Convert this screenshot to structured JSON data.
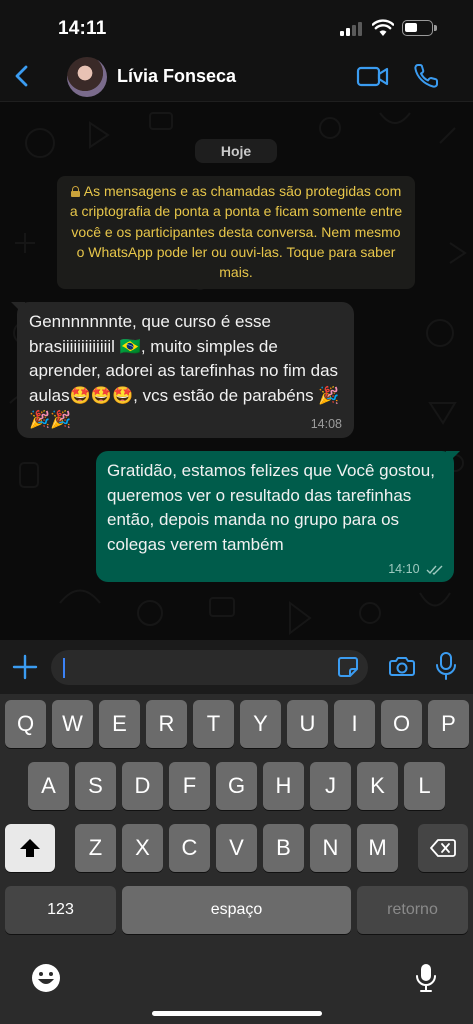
{
  "status_bar": {
    "time": "14:11"
  },
  "header": {
    "contact_name": "Lívia Fonseca"
  },
  "chat": {
    "date_label": "Hoje",
    "encryption_notice": "As mensagens e as chamadas são protegidas com a criptografia de ponta a ponta e ficam somente entre você e os participantes desta conversa. Nem mesmo o WhatsApp pode ler ou ouvi-las. Toque para saber mais.",
    "messages": [
      {
        "direction": "in",
        "text": "Gennnnnnnte, que curso é esse brasiiiiiiiiiiiiil 🇧🇷, muito simples de aprender, adorei as tarefinhas no fim das aulas🤩🤩🤩, vcs estão de parabéns 🎉🎉🎉",
        "time": "14:08"
      },
      {
        "direction": "out",
        "text": "Gratidão, estamos felizes que Você gostou, queremos ver o resultado das tarefinhas então, depois manda no grupo para os colegas verem também",
        "time": "14:10",
        "status": "read"
      }
    ]
  },
  "composer": {
    "value": "",
    "placeholder": ""
  },
  "keyboard": {
    "row1": [
      "Q",
      "W",
      "E",
      "R",
      "T",
      "Y",
      "U",
      "I",
      "O",
      "P"
    ],
    "row2": [
      "A",
      "S",
      "D",
      "F",
      "G",
      "H",
      "J",
      "K",
      "L"
    ],
    "row3": [
      "Z",
      "X",
      "C",
      "V",
      "B",
      "N",
      "M"
    ],
    "numbers_label": "123",
    "space_label": "espaço",
    "return_label": "retorno"
  },
  "colors": {
    "accent": "#3b9cf1",
    "outgoing_bubble": "#005c4b",
    "incoming_bubble": "#262626",
    "notice_text": "#e7c64a"
  }
}
